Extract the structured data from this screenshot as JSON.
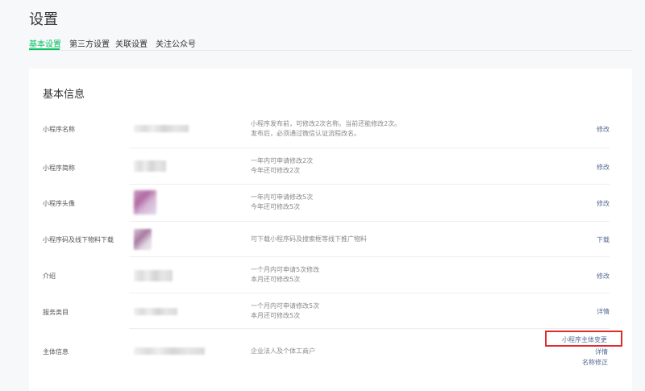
{
  "page": {
    "title": "设置"
  },
  "tabs": [
    {
      "label": "基本设置",
      "active": true
    },
    {
      "label": "第三方设置",
      "active": false
    },
    {
      "label": "关联设置",
      "active": false
    },
    {
      "label": "关注公众号",
      "active": false
    }
  ],
  "card": {
    "title": "基本信息"
  },
  "rows": [
    {
      "label": "小程序名称",
      "desc": [
        "小程序发布前，可修改2次名称。当前还能修改2次。",
        "发布后，必须通过微信认证流程改名。"
      ],
      "action": "修改"
    },
    {
      "label": "小程序简称",
      "desc": [
        "一年内可申请修改2次",
        "今年还可修改2次"
      ],
      "action": "修改"
    },
    {
      "label": "小程序头像",
      "desc": [
        "一年内可申请修改5次",
        "今年还可修改5次"
      ],
      "action": "修改"
    },
    {
      "label": "小程序码及线下物料下载",
      "desc": [
        "可下载小程序码及搜索框等线下推广物料"
      ],
      "action": "下载"
    },
    {
      "label": "介绍",
      "desc": [
        "一个月内可申请5次修改",
        "本月还可修改5次"
      ],
      "action": "修改"
    },
    {
      "label": "服务类目",
      "desc": [
        "一个月内可申请修改5次",
        "本月还可修改5次"
      ],
      "action": "详情"
    },
    {
      "label": "主体信息",
      "desc": [
        "企业法人及个体工商户"
      ],
      "actions": [
        "小程序主体变更",
        "详情",
        "名称修正"
      ]
    }
  ],
  "colors": {
    "accent": "#07c160",
    "link": "#576b95",
    "highlight": "#e02b2b"
  }
}
